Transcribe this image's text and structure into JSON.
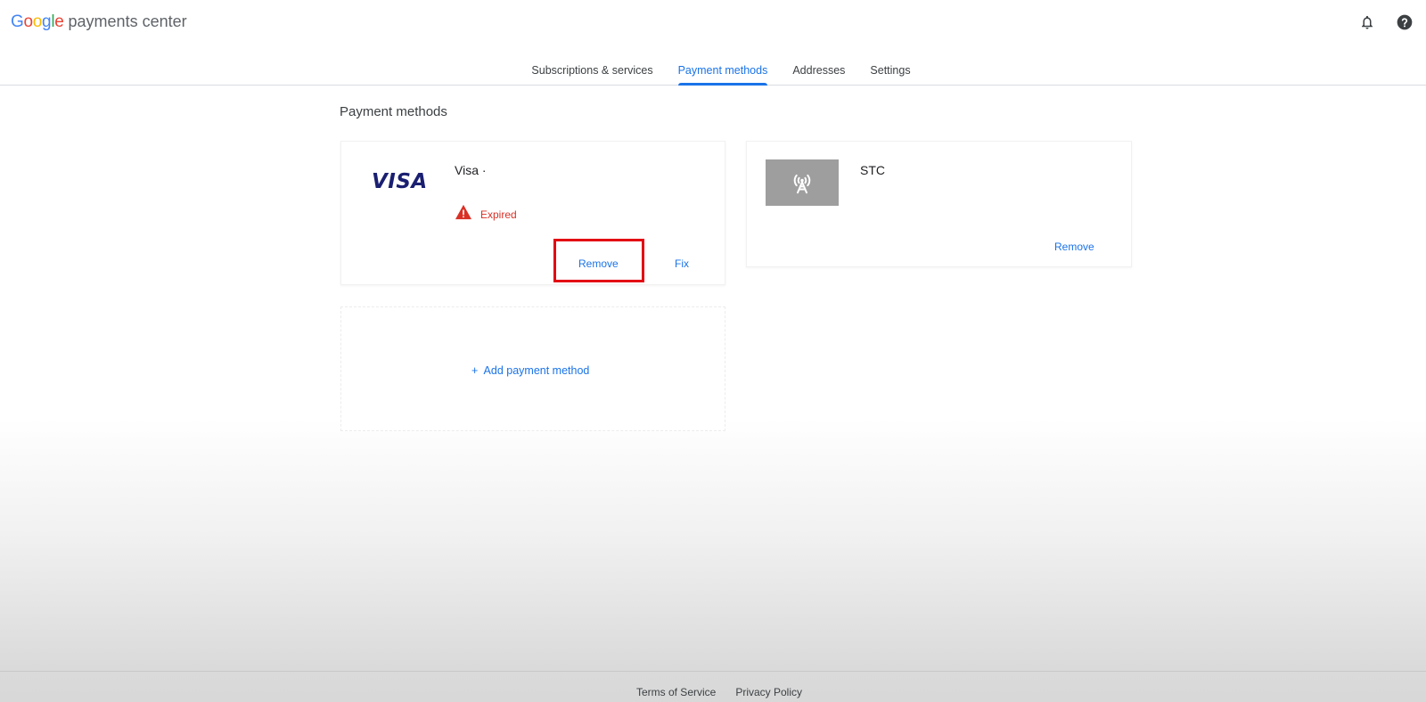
{
  "header": {
    "logo_letters": [
      {
        "ch": "G",
        "color": "#4285f4"
      },
      {
        "ch": "o",
        "color": "#ea4335"
      },
      {
        "ch": "o",
        "color": "#fbbc05"
      },
      {
        "ch": "g",
        "color": "#4285f4"
      },
      {
        "ch": "l",
        "color": "#34a853"
      },
      {
        "ch": "e",
        "color": "#ea4335"
      }
    ],
    "product_name": "payments center",
    "icons": [
      "bell-icon",
      "help-icon"
    ]
  },
  "tabs": [
    {
      "label": "Subscriptions & services",
      "active": false
    },
    {
      "label": "Payment methods",
      "active": true
    },
    {
      "label": "Addresses",
      "active": false
    },
    {
      "label": "Settings",
      "active": false
    }
  ],
  "main": {
    "title": "Payment methods",
    "cards": {
      "visa": {
        "logo_text": "VISA",
        "name": "Visa ·",
        "status": "Expired",
        "remove_label": "Remove",
        "fix_label": "Fix"
      },
      "stc": {
        "name": "STC",
        "icon": "antenna-tower-icon",
        "remove_label": "Remove"
      },
      "add": {
        "label": "+  Add payment method"
      }
    }
  },
  "footer": {
    "terms": "Terms of Service",
    "privacy": "Privacy Policy"
  },
  "colors": {
    "accent": "#1a73e8",
    "error": "#d93025",
    "highlight": "#e30613",
    "visa_blue": "#1a1f71"
  }
}
